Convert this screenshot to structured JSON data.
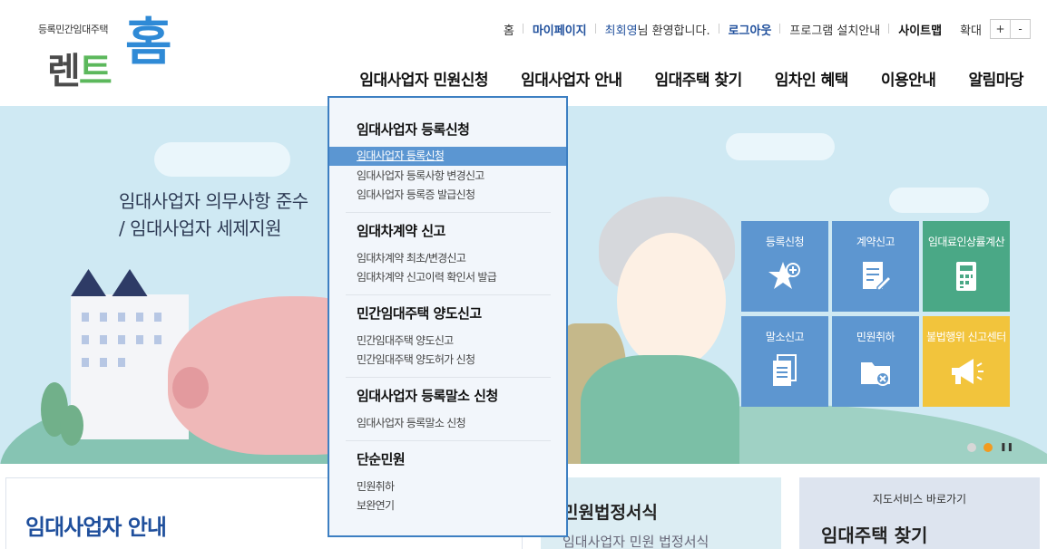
{
  "logo": {
    "sub": "등록민간임대주택",
    "main_a": "렌",
    "main_b": "트",
    "home": "홈"
  },
  "util": {
    "home": "홈",
    "mypage": "마이페이지",
    "user_name": "최회영",
    "welcome": "님 환영합니다.",
    "logout": "로그아웃",
    "program": "프로그램 설치안내",
    "sitemap": "사이트맵",
    "zoom": "확대",
    "zoom_in": "+",
    "zoom_out": "-"
  },
  "gnb": [
    "임대사업자 민원신청",
    "임대사업자 안내",
    "임대주택 찾기",
    "임차인 혜택",
    "이용안내",
    "알림마당"
  ],
  "hero": {
    "line1": "임대사업자 의무사항 준수",
    "line2": "/ 임대사업자 세제지원"
  },
  "tiles": [
    {
      "label": "등록신청",
      "icon": "star-plus-icon",
      "color": "#5d96d0"
    },
    {
      "label": "계약신고",
      "icon": "document-edit-icon",
      "color": "#5d96d0"
    },
    {
      "label": "임대료인상률계산",
      "icon": "calculator-icon",
      "color": "#4aa886"
    },
    {
      "label": "말소신고",
      "icon": "documents-icon",
      "color": "#5d96d0"
    },
    {
      "label": "민원취하",
      "icon": "folder-cancel-icon",
      "color": "#5d96d0"
    },
    {
      "label": "불법행위 신고센터",
      "icon": "megaphone-icon",
      "color": "#f2c43c"
    }
  ],
  "dropdown": {
    "groups": [
      {
        "title": "임대사업자 등록신청",
        "items": [
          "임대사업자 등록신청",
          "임대사업자 등록사항 변경신고",
          "임대사업자 등록증 발급신청"
        ]
      },
      {
        "title": "임대차계약 신고",
        "items": [
          "임대차계약 최초/변경신고",
          "임대차계약 신고이력 확인서 발급"
        ]
      },
      {
        "title": "민간임대주택 양도신고",
        "items": [
          "민간임대주택 양도신고",
          "민간임대주택 양도허가 신청"
        ]
      },
      {
        "title": "임대사업자 등록말소 신청",
        "items": [
          "임대사업자 등록말소 신청"
        ]
      },
      {
        "title": "단순민원",
        "items": [
          "민원취하",
          "보완연기"
        ]
      }
    ]
  },
  "bottom": {
    "card1_title": "임대사업자 안내",
    "card2_title": "민원법정서식",
    "card2_sub": "임대사업자 민원 법정서식",
    "card3_sub": "지도서비스 바로가기",
    "card3_title": "임대주택 찾기"
  }
}
